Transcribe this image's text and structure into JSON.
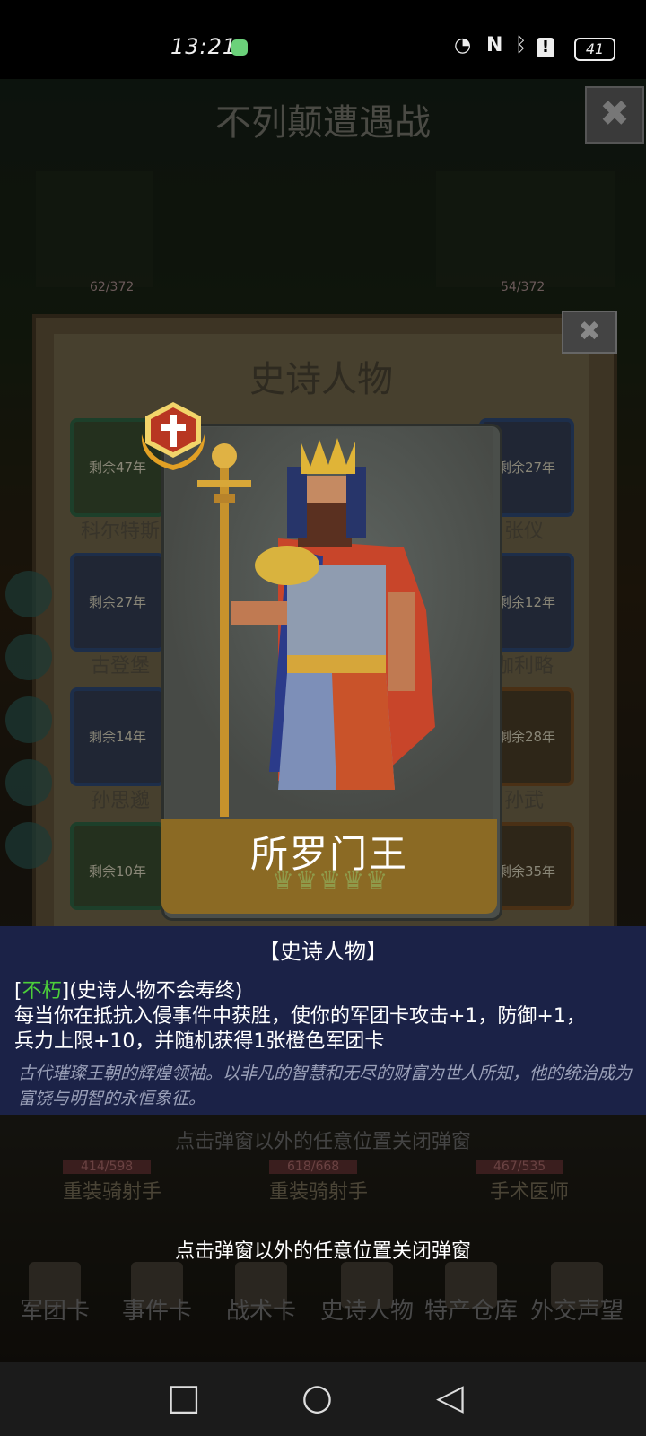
{
  "status_bar": {
    "time": "13:21",
    "battery": "41"
  },
  "background": {
    "title": "不列颠遭遇战",
    "close": "✖",
    "stat_left": "62/372",
    "stat_right": "54/372",
    "hint": "点击弹窗以外的任意位置关闭弹窗",
    "units": [
      {
        "hp": "414/598",
        "name": "重装骑射手"
      },
      {
        "hp": "618/668",
        "name": "重装骑射手"
      },
      {
        "hp": "467/535",
        "name": "手术医师"
      }
    ]
  },
  "panel": {
    "title": "史诗人物",
    "close": "✖",
    "left_slots": [
      {
        "remaining": "剩余47年",
        "name": "科尔特斯"
      },
      {
        "remaining": "剩余27年",
        "name": "古登堡"
      },
      {
        "remaining": "剩余14年",
        "name": "孙思邈"
      },
      {
        "remaining": "剩余10年",
        "name": ""
      }
    ],
    "right_slots": [
      {
        "remaining": "剩余27年",
        "name": "张仪"
      },
      {
        "remaining": "剩余12年",
        "name": "伽利略"
      },
      {
        "remaining": "剩余28年",
        "name": "孙武"
      },
      {
        "remaining": "剩余35年",
        "name": ""
      }
    ]
  },
  "hero_card": {
    "name": "所罗门王",
    "crowns": "♛♛♛♛♛",
    "badge_icon": "cross-laurel-badge-icon",
    "colors": {
      "name_bar": "#8b6a24",
      "badge": "#c0402a"
    }
  },
  "info": {
    "title": "【史诗人物】",
    "trait_open": "[",
    "trait_name": "不朽",
    "trait_rest": "](史诗人物不会寿终)",
    "desc_line1": "每当你在抵抗入侵事件中获胜，使你的军团卡攻击+1，防御+1，",
    "desc_line2": "兵力上限+10，并随机获得1张橙色军团卡",
    "lore": "古代璀璨王朝的辉煌领袖。以非凡的智慧和无尽的财富为世人所知，他的统治成为富饶与明智的永恒象征。"
  },
  "hint": "点击弹窗以外的任意位置关闭弹窗",
  "tabs": [
    {
      "label": "军团卡",
      "icon": "helmet-icon"
    },
    {
      "label": "事件卡",
      "icon": "scroll-icon"
    },
    {
      "label": "战术卡",
      "icon": "shield-swords-icon"
    },
    {
      "label": "史诗人物",
      "icon": "crown-icon"
    },
    {
      "label": "特产仓库",
      "icon": "chest-icon"
    },
    {
      "label": "外交声望",
      "icon": "letter-icon"
    }
  ],
  "nav": {
    "recent": "□",
    "home": "○",
    "back": "◁"
  }
}
